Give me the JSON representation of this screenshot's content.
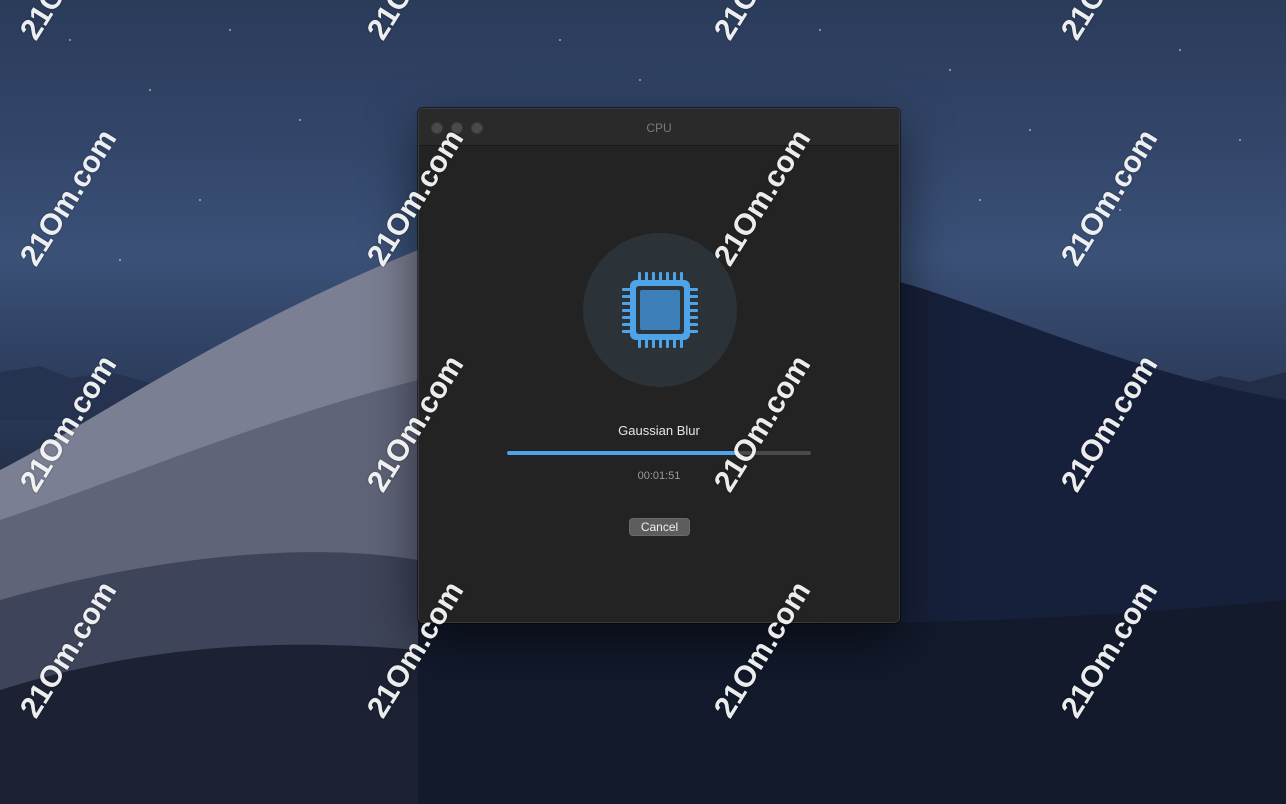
{
  "window": {
    "title": "CPU"
  },
  "task": {
    "name": "Gaussian Blur",
    "elapsed": "00:01:51",
    "progress_percent": 76,
    "icon": "cpu-chip-icon"
  },
  "actions": {
    "cancel_label": "Cancel"
  },
  "watermark": {
    "text": "21Om.com"
  },
  "colors": {
    "accent": "#4fa3e8",
    "window_bg": "#232323",
    "titlebar_bg": "#2a2a2a",
    "icon_circle": "#2c3338"
  }
}
